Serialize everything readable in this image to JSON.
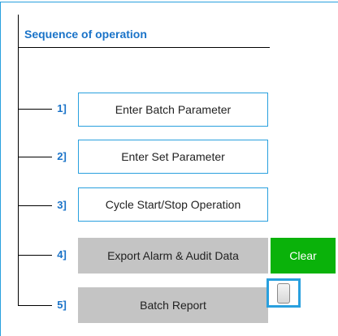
{
  "panel": {
    "title": "Sequence of operation"
  },
  "steps": [
    {
      "number": "1]",
      "label": "Enter Batch Parameter"
    },
    {
      "number": "2]",
      "label": "Enter Set Parameter"
    },
    {
      "number": "3]",
      "label": "Cycle Start/Stop Operation"
    },
    {
      "number": "4]",
      "label": "Export Alarm & Audit Data"
    },
    {
      "number": "5]",
      "label": "Batch Report"
    }
  ],
  "actions": {
    "clear_label": "Clear"
  },
  "colors": {
    "accent_blue": "#29a0de",
    "title_blue": "#1a73c8",
    "button_gray": "#c4c4c4",
    "clear_green": "#0ab20a"
  },
  "icons": {
    "report_toggle": "toggle-switch-icon"
  }
}
